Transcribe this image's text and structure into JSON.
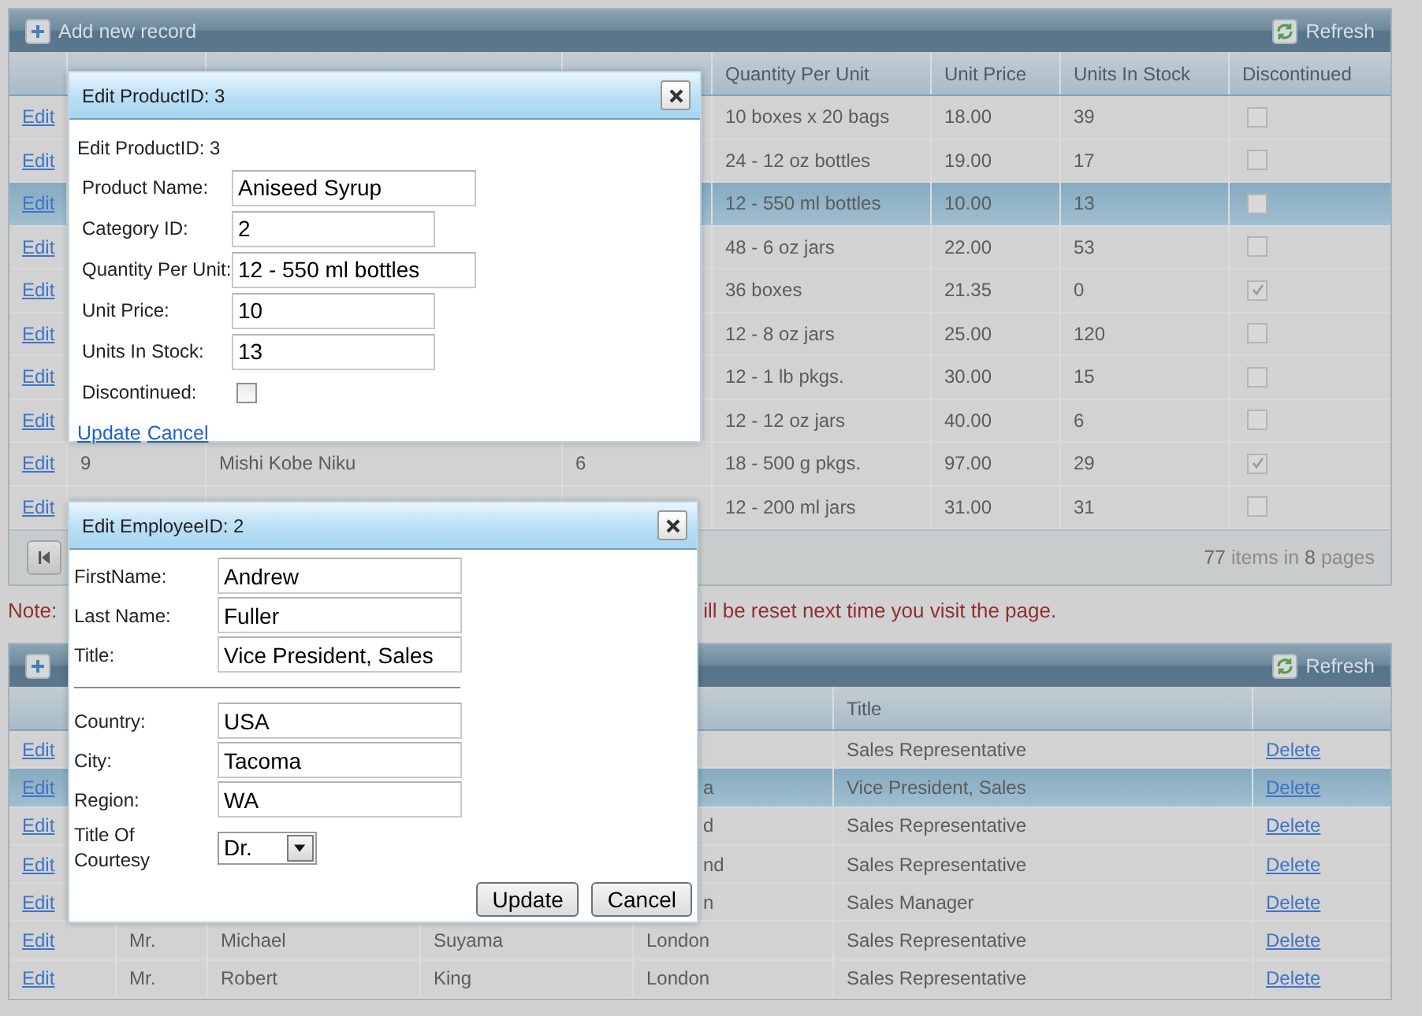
{
  "products_grid": {
    "add_label": "Add new record",
    "refresh_label": "Refresh",
    "columns": [
      {
        "label": "Quantity Per Unit"
      },
      {
        "label": "Unit Price"
      },
      {
        "label": "Units In Stock"
      },
      {
        "label": "Discontinued"
      }
    ],
    "rows": [
      {
        "edit": "Edit",
        "selected": false,
        "quantity_per_unit": "10 boxes x 20 bags",
        "unit_price": "18.00",
        "units_in_stock": "39",
        "discontinued": false
      },
      {
        "edit": "Edit",
        "selected": false,
        "quantity_per_unit": "24 - 12 oz bottles",
        "unit_price": "19.00",
        "units_in_stock": "17",
        "discontinued": false
      },
      {
        "edit": "Edit",
        "selected": true,
        "quantity_per_unit": "12 - 550 ml bottles",
        "unit_price": "10.00",
        "units_in_stock": "13",
        "discontinued": false
      },
      {
        "edit": "Edit",
        "selected": false,
        "quantity_per_unit": "48 - 6 oz jars",
        "unit_price": "22.00",
        "units_in_stock": "53",
        "discontinued": false
      },
      {
        "edit": "Edit",
        "selected": false,
        "quantity_per_unit": "36 boxes",
        "unit_price": "21.35",
        "units_in_stock": "0",
        "discontinued": true
      },
      {
        "edit": "Edit",
        "selected": false,
        "quantity_per_unit": "12 - 8 oz jars",
        "unit_price": "25.00",
        "units_in_stock": "120",
        "discontinued": false
      },
      {
        "edit": "Edit",
        "selected": false,
        "quantity_per_unit": "12 - 1 lb pkgs.",
        "unit_price": "30.00",
        "units_in_stock": "15",
        "discontinued": false
      },
      {
        "edit": "Edit",
        "selected": false,
        "quantity_per_unit": "12 - 12 oz jars",
        "unit_price": "40.00",
        "units_in_stock": "6",
        "discontinued": false
      },
      {
        "edit": "Edit",
        "selected": false,
        "product_id": "9",
        "product_name": "Mishi Kobe Niku",
        "category_id": "6",
        "quantity_per_unit": "18 - 500 g pkgs.",
        "unit_price": "97.00",
        "units_in_stock": "29",
        "discontinued": true
      },
      {
        "edit": "Edit",
        "selected": false,
        "quantity_per_unit": "12 - 200 ml jars",
        "unit_price": "31.00",
        "units_in_stock": "31",
        "discontinued": false
      }
    ],
    "pager": {
      "summary": "**77** items in **8** pages"
    }
  },
  "note": {
    "start": "Note:",
    "end": "ill be reset next time you visit the page."
  },
  "employees_grid": {
    "refresh_label": "Refresh",
    "columns": [
      {
        "label": "Title"
      }
    ],
    "rows": [
      {
        "edit": "Edit",
        "selected": false,
        "title": "Sales Representative",
        "delete": "Delete"
      },
      {
        "edit": "Edit",
        "selected": true,
        "covered": true,
        "city": "a",
        "title": "Vice President, Sales",
        "delete": "Delete"
      },
      {
        "edit": "Edit",
        "selected": false,
        "covered": true,
        "city": "d",
        "title": "Sales Representative",
        "delete": "Delete"
      },
      {
        "edit": "Edit",
        "selected": false,
        "covered": true,
        "city": "nd",
        "title": "Sales Representative",
        "delete": "Delete"
      },
      {
        "edit": "Edit",
        "selected": false,
        "covered": true,
        "city": "n",
        "title": "Sales Manager",
        "delete": "Delete"
      },
      {
        "edit": "Edit",
        "selected": false,
        "title_of_courtesy": "Mr.",
        "first_name": "Michael",
        "last_name": "Suyama",
        "city": "London",
        "title": "Sales Representative",
        "delete": "Delete"
      },
      {
        "edit": "Edit",
        "selected": false,
        "title_of_courtesy": "Mr.",
        "first_name": "Robert",
        "last_name": "King",
        "city": "London",
        "title": "Sales Representative",
        "delete": "Delete"
      }
    ]
  },
  "product_dialog": {
    "title": "Edit ProductID: 3",
    "heading": "Edit ProductID: 3",
    "field_groups": [
      [
        {
          "kind": "text",
          "label": "Product Name:",
          "value": "Aniseed Syrup"
        },
        {
          "kind": "text",
          "label": "Category ID:",
          "value": "2"
        },
        {
          "kind": "text",
          "label": "Quantity Per Unit:",
          "value": "12 - 550 ml bottles"
        },
        {
          "kind": "text",
          "label": "Unit Price:",
          "value": "10"
        },
        {
          "kind": "text",
          "label": "Units In Stock:",
          "value": "13"
        },
        {
          "kind": "checkbox",
          "label": "Discontinued:",
          "checked": false
        }
      ]
    ],
    "actions": {
      "kind": "links",
      "items": [
        "Update",
        "Cancel"
      ]
    }
  },
  "employee_dialog": {
    "title": "Edit EmployeeID: 2",
    "field_groups": [
      [
        {
          "kind": "text",
          "label": "FirstName:",
          "value": "Andrew"
        },
        {
          "kind": "text",
          "label": "Last Name:",
          "value": "Fuller"
        },
        {
          "kind": "text",
          "label": "Title:",
          "value": "Vice President, Sales"
        }
      ],
      [
        {
          "kind": "text",
          "label": "Country:",
          "value": "USA"
        },
        {
          "kind": "text",
          "label": "City:",
          "value": "Tacoma"
        },
        {
          "kind": "text",
          "label": "Region:",
          "value": "WA"
        },
        {
          "kind": "select",
          "label": "Title Of Courtesy",
          "value": "Dr."
        }
      ]
    ],
    "actions": {
      "kind": "buttons",
      "items": [
        "Update",
        "Cancel"
      ]
    }
  }
}
